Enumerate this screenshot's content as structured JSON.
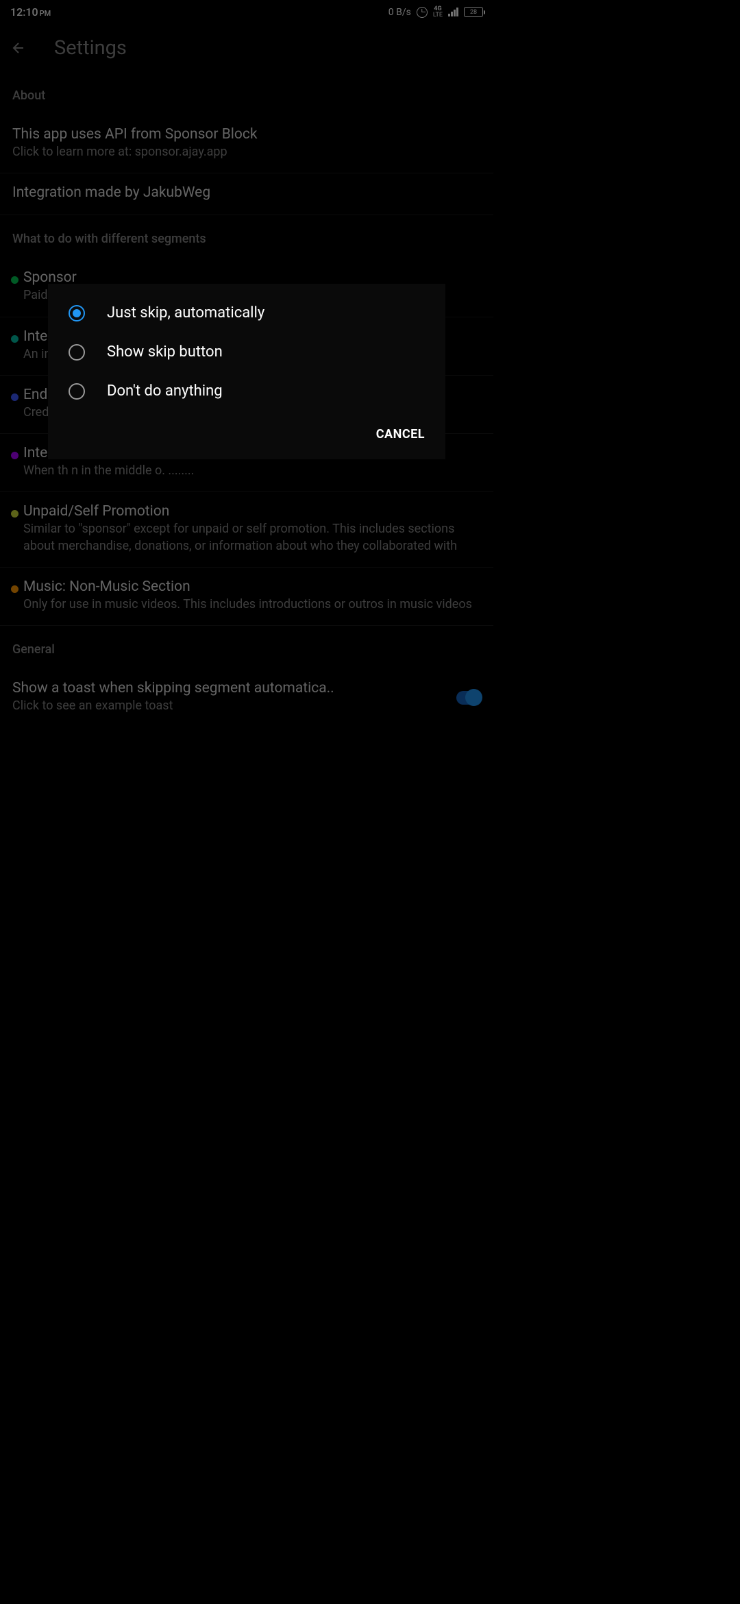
{
  "status_bar": {
    "time": "12:10",
    "ampm": "PM",
    "speed": "0 B/s",
    "network_top": "4G",
    "network_bottom": "LTE",
    "battery": "28"
  },
  "header": {
    "title": "Settings"
  },
  "sections": {
    "about_header": "About",
    "api_title": "This app uses API from Sponsor Block",
    "api_subtitle": "Click to learn more at: sponsor.ajay.app",
    "integration_title": "Integration made by JakubWeg",
    "segments_header": "What to do with different segments",
    "general_header": "General"
  },
  "segments": [
    {
      "color": "#00c853",
      "title": "Sponsor",
      "subtitle": "Paid promotion, paid referrals and direct advertisements"
    },
    {
      "color": "#00bfa5",
      "title": "Inter",
      "subtitle": "An inter                                                                                                            ne, repeatir"
    },
    {
      "color": "#3d5afe",
      "title": "Endc",
      "subtitle": "Credits conclus"
    },
    {
      "color": "#aa00ff",
      "title": "Inter",
      "subtitle": "When th                                                                                                         n in the middle o. ........"
    },
    {
      "color": "#cddc39",
      "title": "Unpaid/Self Promotion",
      "subtitle": "Similar to \"sponsor\" except for unpaid or self promotion. This includes sections about merchandise, donations, or information about who they collaborated with"
    },
    {
      "color": "#ff9800",
      "title": "Music: Non-Music Section",
      "subtitle": "Only for use in music videos. This includes introductions or outros in music videos"
    }
  ],
  "toast": {
    "title": "Show a toast when skipping segment automatica..",
    "subtitle": "Click to see an example toast"
  },
  "dialog": {
    "options": [
      "Just skip, automatically",
      "Show skip button",
      "Don't do anything"
    ],
    "cancel": "CANCEL",
    "selected_index": 0
  }
}
